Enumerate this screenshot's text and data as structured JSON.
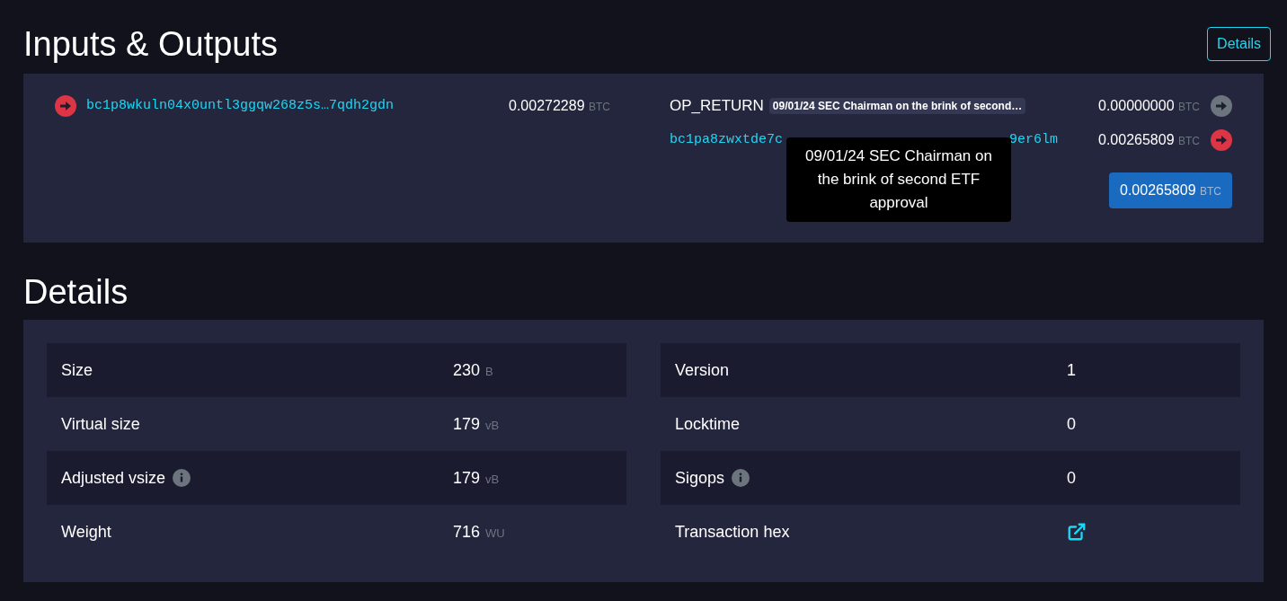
{
  "io": {
    "title": "Inputs & Outputs",
    "details_button": "Details",
    "inputs": [
      {
        "address": "bc1p8wkuln04x0untl3ggqw268z5s…7qdh2gdn",
        "amount": "0.00272289",
        "unit": "BTC",
        "color": "#dc3545"
      }
    ],
    "outputs": [
      {
        "kind": "op_return",
        "label": "OP_RETURN",
        "tag": "09/01/24 SEC Chairman on the brink of second…",
        "amount": "0.00000000",
        "unit": "BTC",
        "color": "#6c757d"
      },
      {
        "kind": "address",
        "address_head": "bc1pa8zwxtde7c",
        "address_tail": "9er6lm",
        "amount": "0.00265809",
        "unit": "BTC",
        "color": "#dc3545"
      }
    ],
    "total": {
      "amount": "0.00265809",
      "unit": "BTC"
    },
    "tooltip": "09/01/24 SEC Chairman on the brink of second ETF approval"
  },
  "details": {
    "title": "Details",
    "left": [
      {
        "label": "Size",
        "value": "230",
        "unit": "B",
        "info": false
      },
      {
        "label": "Virtual size",
        "value": "179",
        "unit": "vB",
        "info": false
      },
      {
        "label": "Adjusted vsize",
        "value": "179",
        "unit": "vB",
        "info": true
      },
      {
        "label": "Weight",
        "value": "716",
        "unit": "WU",
        "info": false
      }
    ],
    "right": [
      {
        "kind": "text",
        "label": "Version",
        "value": "1",
        "info": false
      },
      {
        "kind": "text",
        "label": "Locktime",
        "value": "0",
        "info": false
      },
      {
        "kind": "text",
        "label": "Sigops",
        "value": "0",
        "info": true
      },
      {
        "kind": "link",
        "label": "Transaction hex",
        "info": false
      }
    ]
  }
}
